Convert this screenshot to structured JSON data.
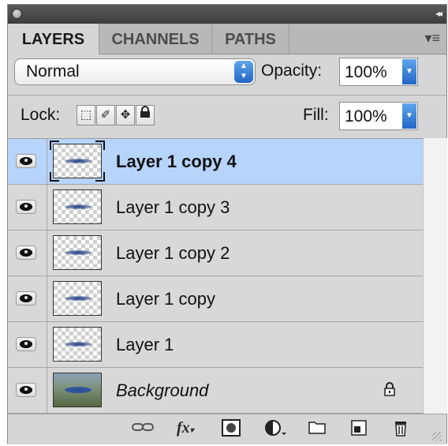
{
  "tabs": [
    {
      "label": "LAYERS",
      "active": true
    },
    {
      "label": "CHANNELS",
      "active": false
    },
    {
      "label": "PATHS",
      "active": false
    }
  ],
  "blend_mode": "Normal",
  "opacity": {
    "label": "Opacity:",
    "value": "100%"
  },
  "fill": {
    "label": "Fill:",
    "value": "100%"
  },
  "lock": {
    "label": "Lock:"
  },
  "layers": [
    {
      "name": "Layer 1 copy 4",
      "selected": true,
      "visible": true
    },
    {
      "name": "Layer 1 copy 3",
      "selected": false,
      "visible": true
    },
    {
      "name": "Layer 1 copy 2",
      "selected": false,
      "visible": true
    },
    {
      "name": "Layer 1 copy",
      "selected": false,
      "visible": true
    },
    {
      "name": "Layer 1",
      "selected": false,
      "visible": true
    },
    {
      "name": "Background",
      "selected": false,
      "visible": true,
      "locked": true
    }
  ],
  "footer_icons": [
    "link-icon",
    "fx-icon",
    "mask-icon",
    "adjustment-icon",
    "folder-icon",
    "new-layer-icon",
    "trash-icon"
  ],
  "colors": {
    "selected_row": "#b7d4fb",
    "accent": "#2f7ad9"
  }
}
